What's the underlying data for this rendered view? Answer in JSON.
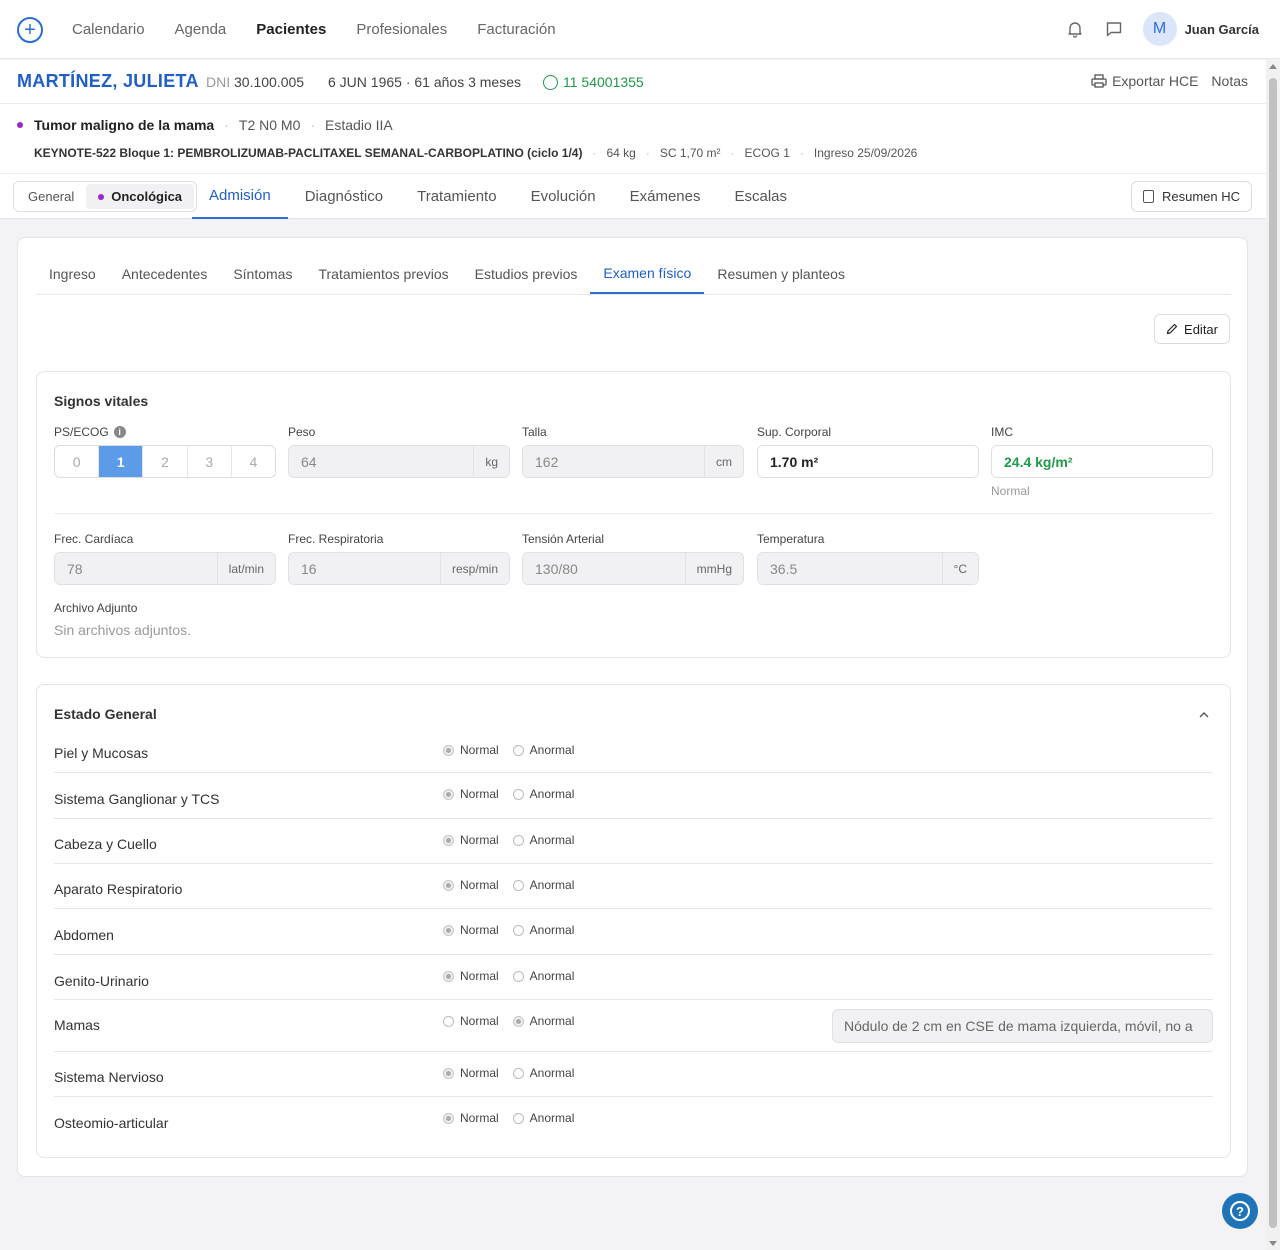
{
  "nav": {
    "links": [
      "Calendario",
      "Agenda",
      "Pacientes",
      "Profesionales",
      "Facturación"
    ],
    "active": "Pacientes",
    "user_initial": "M",
    "user_name": "Juan García"
  },
  "patient": {
    "name": "MARTÍNEZ, JULIETA",
    "dni_label": "DNI",
    "dni": "30.100.005",
    "birth": "6 JUN 1965 · 61 años 3 meses",
    "phone": "11 54001355",
    "export_label": "Exportar HCE",
    "notes_label": "Notas"
  },
  "diagnosis": {
    "title": "Tumor maligno de la mama",
    "tnm": "T2 N0 M0",
    "stage": "Estadio IIA",
    "scheme": "KEYNOTE-522 Bloque 1: PEMBROLIZUMAB-PACLITAXEL SEMANAL-CARBOPLATINO (ciclo 1/4)",
    "weight": "64 kg",
    "sc": "SC 1,70 m²",
    "ecog": "ECOG 1",
    "admission": "Ingreso 25/09/2026"
  },
  "toggle": {
    "general": "General",
    "oncologica": "Oncológica"
  },
  "main_tabs": [
    "Admisión",
    "Diagnóstico",
    "Tratamiento",
    "Evolución",
    "Exámenes",
    "Escalas"
  ],
  "resumen_label": "Resumen HC",
  "sub_tabs": [
    "Ingreso",
    "Antecedentes",
    "Síntomas",
    "Tratamientos previos",
    "Estudios previos",
    "Examen físico",
    "Resumen y planteos"
  ],
  "edit_label": "Editar",
  "vitals": {
    "title": "Signos vitales",
    "ecog_label": "PS/ECOG",
    "ecog_options": [
      "0",
      "1",
      "2",
      "3",
      "4"
    ],
    "ecog_selected": "1",
    "peso_label": "Peso",
    "peso": "64",
    "peso_unit": "kg",
    "talla_label": "Talla",
    "talla": "162",
    "talla_unit": "cm",
    "sup_label": "Sup. Corporal",
    "sup": "1.70 m²",
    "imc_label": "IMC",
    "imc": "24.4 kg/m²",
    "imc_note": "Normal",
    "fc_label": "Frec. Cardíaca",
    "fc": "78",
    "fc_unit": "lat/min",
    "fr_label": "Frec. Respiratoria",
    "fr": "16",
    "fr_unit": "resp/min",
    "ta_label": "Tensión Arterial",
    "ta": "130/80",
    "ta_unit": "mmHg",
    "temp_label": "Temperatura",
    "temp": "36.5",
    "temp_unit": "°C",
    "attach_label": "Archivo Adjunto",
    "attach_value": "Sin archivos adjuntos."
  },
  "estado": {
    "title": "Estado General",
    "normal_label": "Normal",
    "anormal_label": "Anormal",
    "rows": [
      {
        "label": "Piel y Mucosas",
        "value": "Normal"
      },
      {
        "label": "Sistema Ganglionar y TCS",
        "value": "Normal"
      },
      {
        "label": "Cabeza y Cuello",
        "value": "Normal"
      },
      {
        "label": "Aparato Respiratorio",
        "value": "Normal"
      },
      {
        "label": "Abdomen",
        "value": "Normal"
      },
      {
        "label": "Genito-Urinario",
        "value": "Normal"
      },
      {
        "label": "Mamas",
        "value": "Anormal",
        "note": "Nódulo de 2 cm en CSE de mama izquierda, móvil, no a"
      },
      {
        "label": "Sistema Nervioso",
        "value": "Normal"
      },
      {
        "label": "Osteomio-articular",
        "value": "Normal"
      }
    ]
  }
}
